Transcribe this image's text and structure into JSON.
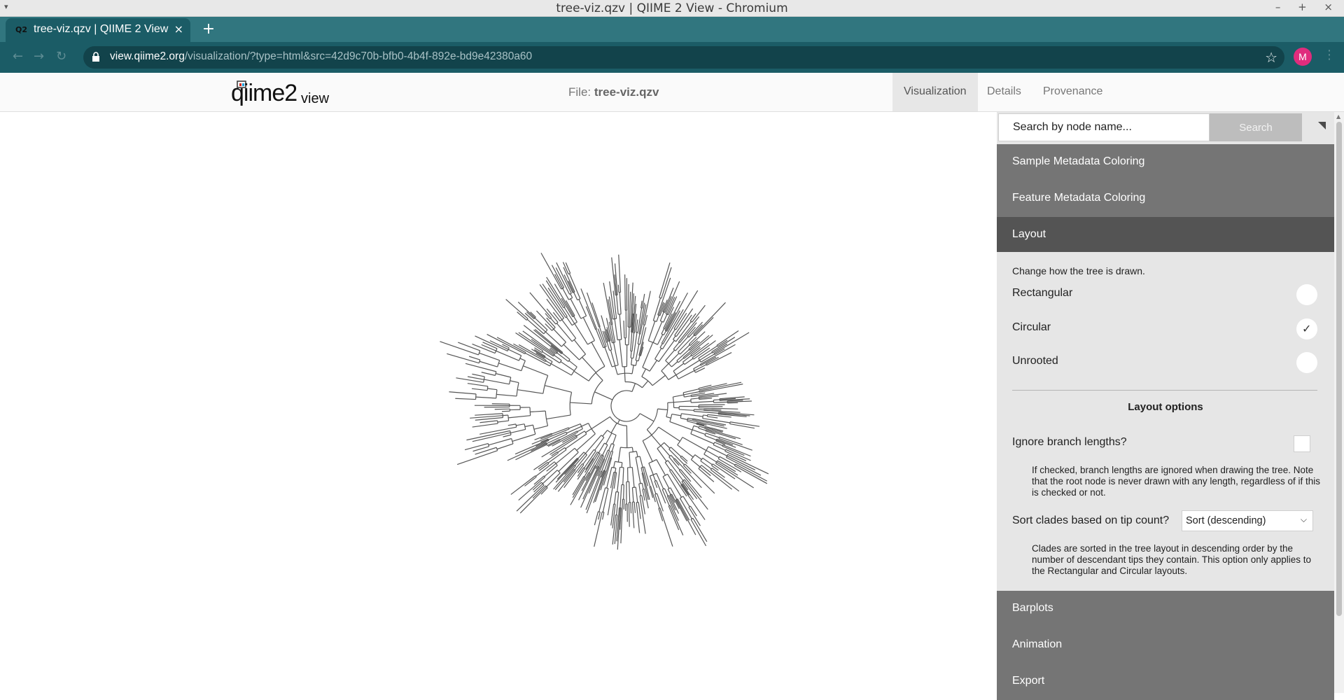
{
  "window": {
    "title": "tree-viz.qzv | QIIME 2 View - Chromium",
    "controls": "– + ×"
  },
  "browser": {
    "tab_title": "tree-viz.qzv | QIIME 2 View",
    "tab_favicon": "Q2",
    "tab_close": "×",
    "new_tab": "+",
    "url_host": "view.qiime2.org",
    "url_path": "/visualization/?type=html&src=42d9c70b-bfb0-4b4f-892e-bd9e42380a60",
    "profile_initial": "M"
  },
  "header": {
    "logo_main": "qiime2",
    "logo_sub": "view",
    "file_prefix": "File:",
    "file_name": "tree-viz.qzv",
    "tabs": [
      {
        "label": "Visualization",
        "active": true
      },
      {
        "label": "Details",
        "active": false
      },
      {
        "label": "Provenance",
        "active": false
      }
    ]
  },
  "panel": {
    "search_placeholder": "Search by node name...",
    "search_button": "Search",
    "sections": {
      "sample_metadata": "Sample Metadata Coloring",
      "feature_metadata": "Feature Metadata Coloring",
      "layout": "Layout",
      "barplots": "Barplots",
      "animation": "Animation",
      "export": "Export"
    },
    "layout": {
      "description": "Change how the tree is drawn.",
      "options": [
        {
          "label": "Rectangular",
          "selected": false
        },
        {
          "label": "Circular",
          "selected": true
        },
        {
          "label": "Unrooted",
          "selected": false
        }
      ],
      "options_heading": "Layout options",
      "ignore_branch_label": "Ignore branch lengths?",
      "ignore_branch_checked": false,
      "ignore_branch_help": "If checked, branch lengths are ignored when drawing the tree. Note that the root node is never drawn with any length, regardless of if this is checked or not.",
      "sort_label": "Sort clades based on tip count?",
      "sort_value": "Sort (descending)",
      "sort_help": "Clades are sorted in the tree layout in descending order by the number of descendant tips they contain. This option only applies to the Rectangular and Circular layouts."
    }
  },
  "colors": {
    "tab_strip": "#31767f",
    "toolbar": "#1b5c66",
    "accordion": "#757575",
    "accordion_open": "#545454",
    "panel_bg": "#e6e6e6",
    "tree_stroke": "#555555",
    "profile": "#e02c7d"
  },
  "icons": {
    "lock": "lock-icon",
    "star": "star-icon",
    "check": "check-icon",
    "collapse": "collapse-triangle-icon"
  }
}
